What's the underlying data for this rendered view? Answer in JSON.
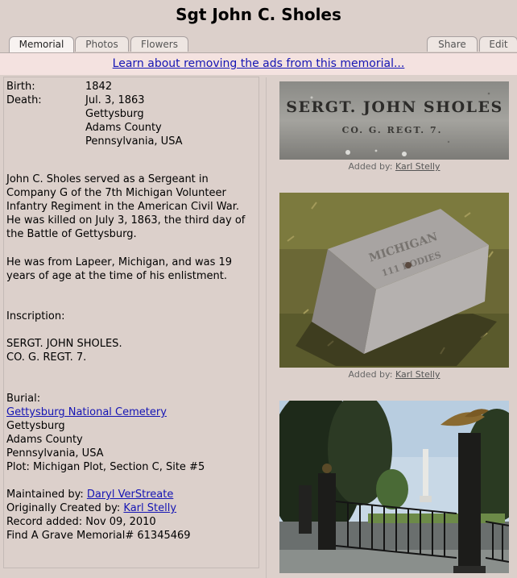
{
  "page": {
    "title": "Sgt John C. Sholes"
  },
  "tabs": {
    "left": [
      "Memorial",
      "Photos",
      "Flowers"
    ],
    "right": [
      "Share",
      "Edit"
    ]
  },
  "ad": {
    "link_text": "Learn about removing the ads from this memorial..."
  },
  "vitals": {
    "birth_label": "Birth:",
    "birth_value": "1842",
    "death_label": "Death:",
    "death_lines": [
      "Jul. 3, 1863",
      "Gettysburg",
      "Adams County",
      "Pennsylvania, USA"
    ]
  },
  "bio": {
    "paragraph1": [
      "John C. Sholes served as a Sergeant in",
      "Company G of the 7th Michigan Volunteer",
      "Infantry Regiment in the American Civil War.",
      "He was killed on July 3, 1863, the third day of",
      "the Battle of Gettysburg."
    ],
    "paragraph2": [
      "He was from Lapeer, Michigan, and was 19",
      "years of age at the time of his enlistment."
    ]
  },
  "inscription": {
    "label": "Inscription:",
    "lines": [
      "SERGT. JOHN SHOLES.",
      "CO. G. REGT. 7."
    ]
  },
  "burial": {
    "label": "Burial:",
    "cemetery": "Gettysburg National Cemetery",
    "lines": [
      "Gettysburg",
      "Adams County",
      "Pennsylvania, USA",
      "Plot: Michigan Plot, Section C, Site #5"
    ]
  },
  "meta": {
    "maintained_label": "Maintained by:",
    "maintained_by": "Daryl VerStreate",
    "created_label": "Originally Created by:",
    "created_by": "Karl Stelly",
    "record_added": "Record added: Nov 09, 2010",
    "memorial_id": "Find A Grave Memorial# 61345469"
  },
  "photos": [
    {
      "stone_line1": "SERGT. JOHN SHOLES",
      "stone_line2": "CO. G. REGT. 7.",
      "added_label": "Added by:",
      "added_by": "Karl Stelly"
    },
    {
      "stone_line1": "MICHIGAN",
      "stone_line2": "111 BODIES",
      "added_label": "Added by:",
      "added_by": "Karl Stelly"
    },
    {
      "added_label": "",
      "added_by": ""
    }
  ]
}
